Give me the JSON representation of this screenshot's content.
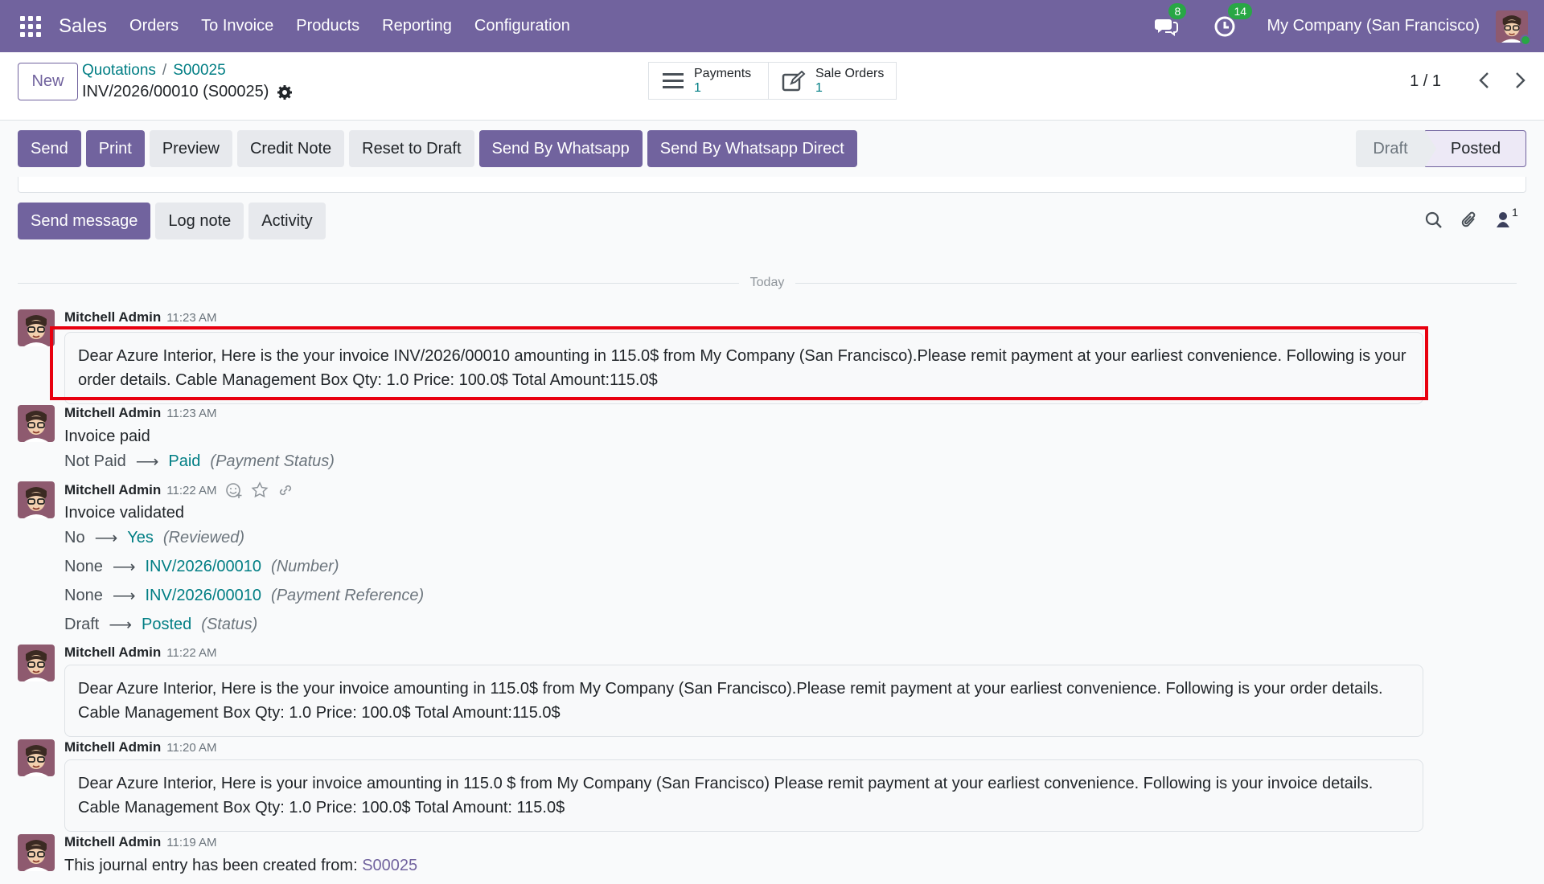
{
  "navbar": {
    "brand": "Sales",
    "menu": [
      "Orders",
      "To Invoice",
      "Products",
      "Reporting",
      "Configuration"
    ],
    "messages_count": "8",
    "activities_count": "14",
    "company": "My Company (San Francisco)"
  },
  "control_panel": {
    "new_label": "New",
    "breadcrumb": [
      "Quotations",
      "S00025"
    ],
    "record_title": "INV/2026/00010 (S00025)",
    "smart_buttons": [
      {
        "label": "Payments",
        "count": "1",
        "icon": "list-icon"
      },
      {
        "label": "Sale Orders",
        "count": "1",
        "icon": "edit-icon"
      }
    ],
    "pager": "1 / 1"
  },
  "actions": {
    "send": "Send",
    "print": "Print",
    "preview": "Preview",
    "credit_note": "Credit Note",
    "reset_to_draft": "Reset to Draft",
    "send_whatsapp": "Send By Whatsapp",
    "send_whatsapp_direct": "Send By Whatsapp Direct"
  },
  "statusbar": {
    "stages": [
      "Draft",
      "Posted"
    ],
    "current": "Posted"
  },
  "chatter": {
    "send_message": "Send message",
    "log_note": "Log note",
    "activity": "Activity",
    "followers_count": "1",
    "date_separator": "Today",
    "messages": [
      {
        "author": "Mitchell Admin",
        "time": "11:23 AM",
        "body": "Dear Azure Interior, Here is the your invoice INV/2026/00010 amounting in 115.0$ from My Company (San Francisco).Please remit payment at your earliest convenience. Following is your order details. Cable Management Box Qty: 1.0 Price: 100.0$ Total Amount:115.0$"
      },
      {
        "author": "Mitchell Admin",
        "time": "11:23 AM",
        "body": "Invoice paid",
        "tracking": [
          {
            "old": "Not Paid",
            "new": "Paid",
            "field": "(Payment Status)"
          }
        ]
      },
      {
        "author": "Mitchell Admin",
        "time": "11:22 AM",
        "body": "Invoice validated",
        "tracking": [
          {
            "old": "No",
            "new": "Yes",
            "field": "(Reviewed)"
          },
          {
            "old": "None",
            "new": "INV/2026/00010",
            "field": "(Number)"
          },
          {
            "old": "None",
            "new": "INV/2026/00010",
            "field": "(Payment Reference)"
          },
          {
            "old": "Draft",
            "new": "Posted",
            "field": "(Status)"
          }
        ]
      },
      {
        "author": "Mitchell Admin",
        "time": "11:22 AM",
        "body": "Dear Azure Interior, Here is the your invoice amounting in 115.0$ from My Company (San Francisco).Please remit payment at your earliest convenience. Following is your order details. Cable Management Box Qty: 1.0 Price: 100.0$ Total Amount:115.0$"
      },
      {
        "author": "Mitchell Admin",
        "time": "11:20 AM",
        "body": "Dear Azure Interior, Here is your invoice amounting in 115.0 $ from My Company (San Francisco) Please remit payment at your earliest convenience. Following is your invoice details. Cable Management Box Qty: 1.0 Price: 100.0$ Total Amount: 115.0$"
      },
      {
        "author": "Mitchell Admin",
        "time": "11:19 AM",
        "body_prefix": "This journal entry has been created from:",
        "body_link": "S00025"
      }
    ]
  },
  "colors": {
    "brand": "#71639e",
    "link": "#017e84",
    "highlight": "#e8000f",
    "badge": "#28a745"
  }
}
